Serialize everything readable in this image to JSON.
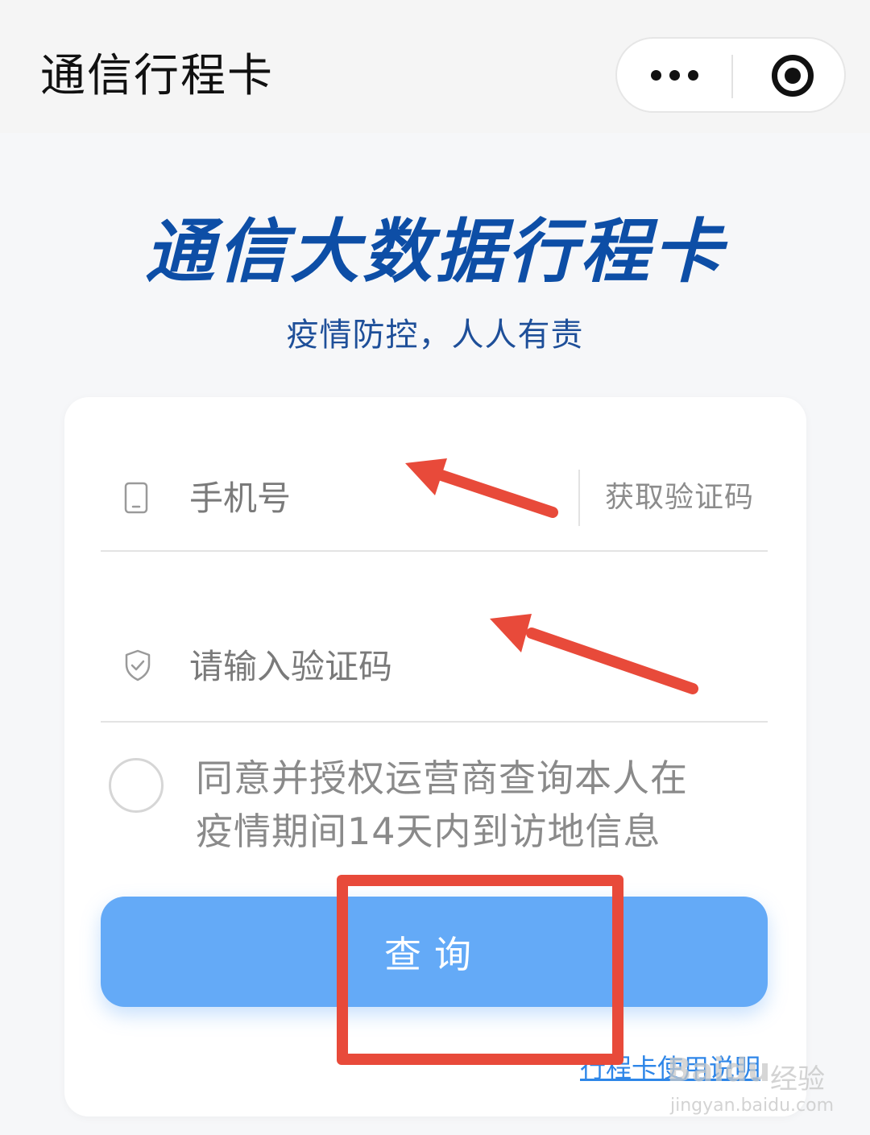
{
  "topbar": {
    "title": "通信行程卡",
    "more_icon": "more-dots-icon",
    "close_icon": "target-close-icon"
  },
  "hero": {
    "title": "通信大数据行程卡",
    "subtitle": "疫情防控，人人有责"
  },
  "form": {
    "phone_placeholder": "手机号",
    "phone_icon": "phone-icon",
    "get_code_label": "获取验证码",
    "code_placeholder": "请输入验证码",
    "code_icon": "shield-check-icon",
    "agree_line1": "同意并授权运营商查询本人在",
    "agree_line2": "疫情期间14天内到访地信息",
    "query_label": "查询",
    "help_link": "行程卡使用说明"
  },
  "watermark": {
    "logo": "Baidu",
    "text": "经验",
    "url": "jingyan.baidu.com"
  },
  "colors": {
    "title_blue": "#0d4ea6",
    "button_blue": "#64aaf7",
    "annotation_red": "#e84a3a"
  }
}
